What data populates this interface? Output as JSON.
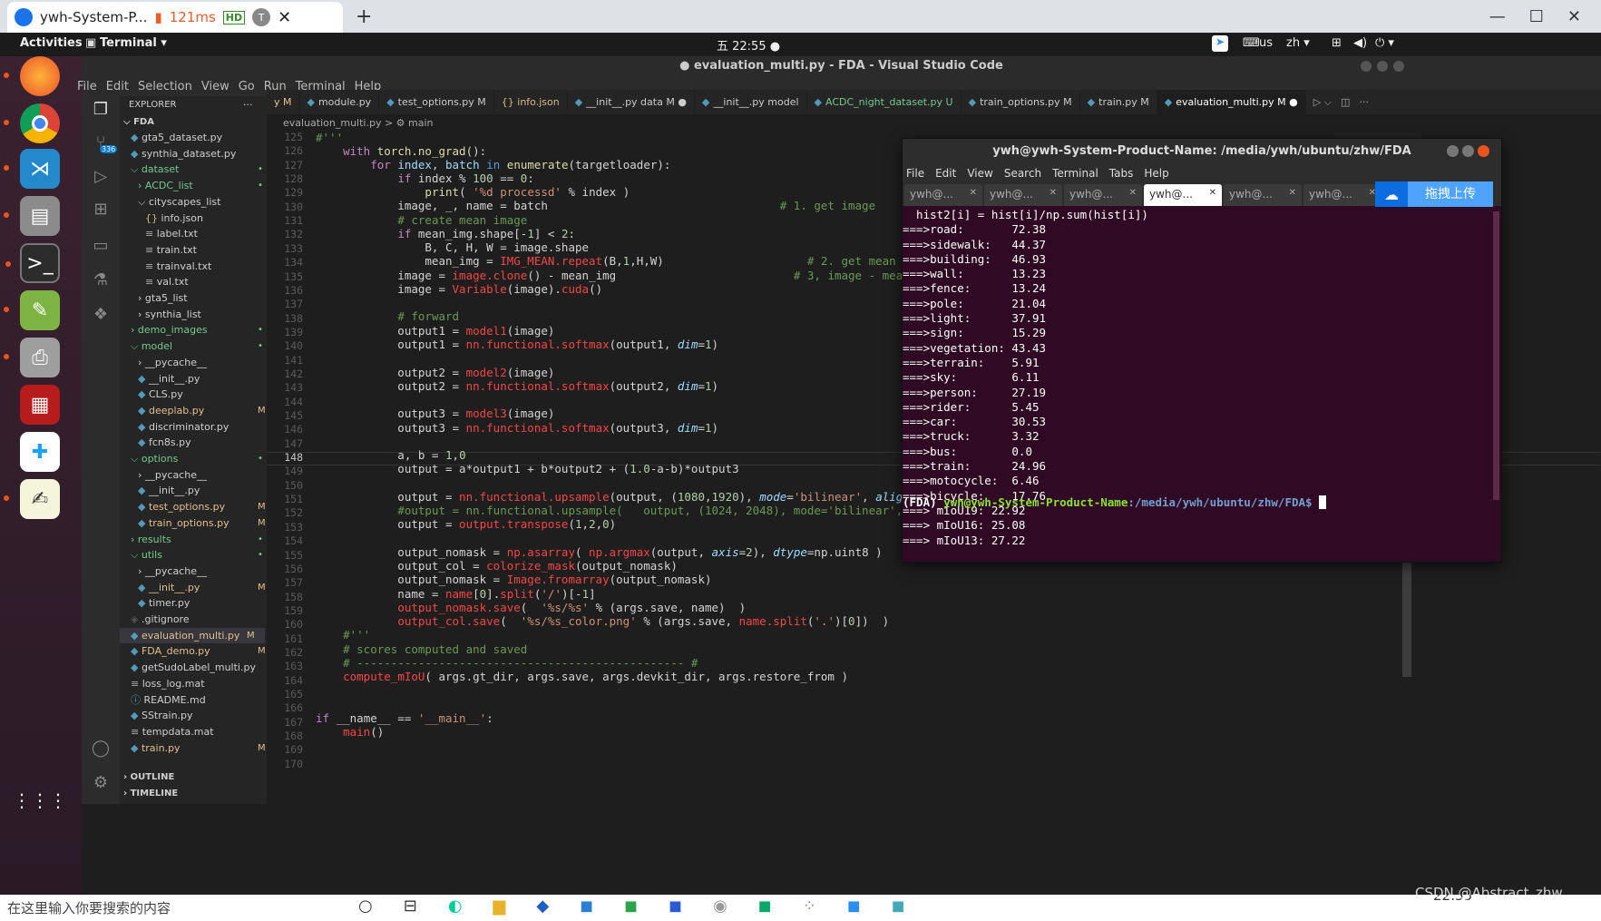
{
  "remote": {
    "tab_title": "ywh-System-P...",
    "latency": "121ms",
    "hd_badge": "HD",
    "t_badge": "T"
  },
  "gnome": {
    "activities": "Activities",
    "app_menu": "Terminal ▾",
    "clock": "五 22:55 ●",
    "input_method": "us",
    "language": "zh ▾"
  },
  "vscode": {
    "title": "● evaluation_multi.py - FDA - Visual Studio Code",
    "menu": [
      "File",
      "Edit",
      "Selection",
      "View",
      "Go",
      "Run",
      "Terminal",
      "Help"
    ],
    "sidebar": {
      "header": "EXPLORER",
      "header_more": "···",
      "root": "FDA",
      "items": [
        {
          "label": "gta5_dataset.py",
          "indent": 0,
          "kind": "py",
          "mark": ""
        },
        {
          "label": "synthia_dataset.py",
          "indent": 0,
          "kind": "py",
          "mark": ""
        },
        {
          "label": "dataset",
          "indent": 0,
          "kind": "folder-open",
          "mark": "•"
        },
        {
          "label": "ACDC_list",
          "indent": 1,
          "kind": "folder",
          "mark": "•"
        },
        {
          "label": "cityscapes_list",
          "indent": 1,
          "kind": "folder-open",
          "mark": ""
        },
        {
          "label": "info.json",
          "indent": 2,
          "kind": "json",
          "mark": ""
        },
        {
          "label": "label.txt",
          "indent": 2,
          "kind": "txt",
          "mark": ""
        },
        {
          "label": "train.txt",
          "indent": 2,
          "kind": "txt",
          "mark": ""
        },
        {
          "label": "trainval.txt",
          "indent": 2,
          "kind": "txt",
          "mark": ""
        },
        {
          "label": "val.txt",
          "indent": 2,
          "kind": "txt",
          "mark": ""
        },
        {
          "label": "gta5_list",
          "indent": 1,
          "kind": "folder",
          "mark": ""
        },
        {
          "label": "synthia_list",
          "indent": 1,
          "kind": "folder",
          "mark": ""
        },
        {
          "label": "demo_images",
          "indent": 0,
          "kind": "folder",
          "mark": "•"
        },
        {
          "label": "model",
          "indent": 0,
          "kind": "folder-open",
          "mark": "•"
        },
        {
          "label": "__pycache__",
          "indent": 1,
          "kind": "folder",
          "mark": ""
        },
        {
          "label": "__init__.py",
          "indent": 1,
          "kind": "py",
          "mark": ""
        },
        {
          "label": "CLS.py",
          "indent": 1,
          "kind": "py",
          "mark": ""
        },
        {
          "label": "deeplab.py",
          "indent": 1,
          "kind": "py",
          "mark": "M"
        },
        {
          "label": "discriminator.py",
          "indent": 1,
          "kind": "py",
          "mark": ""
        },
        {
          "label": "fcn8s.py",
          "indent": 1,
          "kind": "py",
          "mark": ""
        },
        {
          "label": "options",
          "indent": 0,
          "kind": "folder-open",
          "mark": "•"
        },
        {
          "label": "__pycache__",
          "indent": 1,
          "kind": "folder",
          "mark": ""
        },
        {
          "label": "__init__.py",
          "indent": 1,
          "kind": "py",
          "mark": ""
        },
        {
          "label": "test_options.py",
          "indent": 1,
          "kind": "py",
          "mark": "M"
        },
        {
          "label": "train_options.py",
          "indent": 1,
          "kind": "py",
          "mark": "M"
        },
        {
          "label": "results",
          "indent": 0,
          "kind": "folder",
          "mark": "•"
        },
        {
          "label": "utils",
          "indent": 0,
          "kind": "folder-open",
          "mark": "•"
        },
        {
          "label": "__pycache__",
          "indent": 1,
          "kind": "folder",
          "mark": ""
        },
        {
          "label": "__init__.py",
          "indent": 1,
          "kind": "py",
          "mark": "M"
        },
        {
          "label": "timer.py",
          "indent": 1,
          "kind": "py",
          "mark": ""
        },
        {
          "label": ".gitignore",
          "indent": 0,
          "kind": "git",
          "mark": ""
        },
        {
          "label": "evaluation_multi.py",
          "indent": 0,
          "kind": "py",
          "mark": "M"
        },
        {
          "label": "FDA_demo.py",
          "indent": 0,
          "kind": "py",
          "mark": "M"
        },
        {
          "label": "getSudoLabel_multi.py",
          "indent": 0,
          "kind": "py",
          "mark": ""
        },
        {
          "label": "loss_log.mat",
          "indent": 0,
          "kind": "txt",
          "mark": ""
        },
        {
          "label": "README.md",
          "indent": 0,
          "kind": "info",
          "mark": ""
        },
        {
          "label": "SStrain.py",
          "indent": 0,
          "kind": "py",
          "mark": ""
        },
        {
          "label": "tempdata.mat",
          "indent": 0,
          "kind": "txt",
          "mark": ""
        },
        {
          "label": "train.py",
          "indent": 0,
          "kind": "py",
          "mark": "M"
        }
      ],
      "outline": "OUTLINE",
      "timeline": "TIMELINE"
    },
    "tabs": [
      {
        "label": "y M",
        "active": false
      },
      {
        "label": "module.py",
        "active": false
      },
      {
        "label": "test_options.py M",
        "active": false
      },
      {
        "label": "{} info.json",
        "active": false
      },
      {
        "label": "__init__.py data M ●",
        "active": false
      },
      {
        "label": "__init__.py model",
        "active": false
      },
      {
        "label": "ACDC_night_dataset.py U",
        "active": false
      },
      {
        "label": "train_options.py M",
        "active": false
      },
      {
        "label": "train.py M",
        "active": false
      },
      {
        "label": "evaluation_multi.py M ●",
        "active": true
      }
    ],
    "breadcrumb": "evaluation_multi.py  >  ⚙ main",
    "scm_badge": "336",
    "line_numbers": [
      "125",
      "126",
      "127",
      "128",
      "129",
      "130",
      "131",
      "132",
      "133",
      "134",
      "135",
      "136",
      "137",
      "138",
      "139",
      "140",
      "141",
      "142",
      "143",
      "144",
      "145",
      "146",
      "147",
      "148",
      "149",
      "150",
      "151",
      "152",
      "153",
      "154",
      "155",
      "156",
      "157",
      "158",
      "159",
      "160",
      "161",
      "162",
      "163",
      "164",
      "165",
      "166",
      "167",
      "168",
      "169",
      "170"
    ]
  },
  "terminal": {
    "title": "ywh@ywh-System-Product-Name: /media/ywh/ubuntu/zhw/FDA",
    "menu": [
      "File",
      "Edit",
      "View",
      "Search",
      "Terminal",
      "Tabs",
      "Help"
    ],
    "tabs": [
      "ywh@...",
      "ywh@...",
      "ywh@...",
      "ywh@...",
      "ywh@...",
      "ywh@..."
    ],
    "upload_label": "拖拽上传",
    "lines": [
      "  hist2[i] = hist[i]/np.sum(hist[i])",
      "===>road:       72.38",
      "===>sidewalk:   44.37",
      "===>building:   46.93",
      "===>wall:       13.23",
      "===>fence:      13.24",
      "===>pole:       21.04",
      "===>light:      37.91",
      "===>sign:       15.29",
      "===>vegetation: 43.43",
      "===>terrain:    5.91",
      "===>sky:        6.11",
      "===>person:     27.19",
      "===>rider:      5.45",
      "===>car:        30.53",
      "===>truck:      3.32",
      "===>bus:        0.0",
      "===>train:      24.96",
      "===>motocycle:  6.46",
      "===>bicycle:    17.76",
      "===> mIoU19: 22.92",
      "===> mIoU16: 25.08",
      "===> mIoU13: 27.22"
    ],
    "prompt_env": "(FDA) ",
    "prompt_user": "ywh@ywh-System-Product-Name",
    "prompt_path": ":/media/ywh/ubuntu/zhw/FDA$ "
  },
  "taskbar": {
    "search_text": "在这里输入你要搜索的内容",
    "watermark": "CSDN @Abstract_zhw",
    "clock": "22:55"
  },
  "colors": {
    "vscode_bg": "#1e1e1e",
    "terminal_bg": "#300a24",
    "dock": "#3b2130",
    "accent": "#e95420"
  }
}
